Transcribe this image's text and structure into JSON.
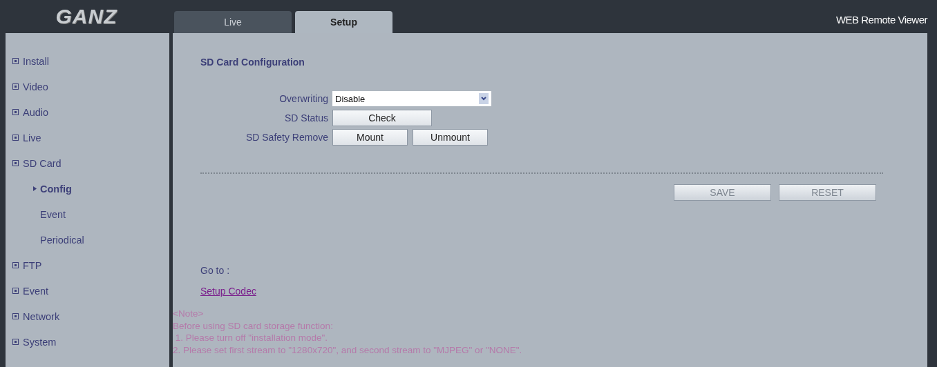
{
  "logo": {
    "text": "GANZ"
  },
  "tabs": [
    {
      "label": "Live",
      "selected": false
    },
    {
      "label": "Setup",
      "selected": true
    }
  ],
  "app_title": "WEB Remote Viewer",
  "sidebar": {
    "items": [
      {
        "label": "Install",
        "selected": false
      },
      {
        "label": "Video",
        "selected": false
      },
      {
        "label": "Audio",
        "selected": false
      },
      {
        "label": "Live",
        "selected": false
      },
      {
        "label": "SD Card",
        "selected": false,
        "children": [
          {
            "label": "Config",
            "selected": true
          },
          {
            "label": "Event",
            "selected": false
          },
          {
            "label": "Periodical",
            "selected": false
          }
        ]
      },
      {
        "label": "FTP",
        "selected": false
      },
      {
        "label": "Event",
        "selected": false
      },
      {
        "label": "Network",
        "selected": false
      },
      {
        "label": "System",
        "selected": false
      }
    ]
  },
  "section_title": "SD Card Configuration",
  "form": [
    {
      "kind": "select",
      "label": "Overwriting",
      "value": "Disable"
    },
    {
      "kind": "buttons",
      "label": "SD Status",
      "buttons": [
        "Check"
      ]
    },
    {
      "kind": "buttons",
      "label": "SD Safety Remove",
      "buttons": [
        "Mount",
        "Unmount"
      ]
    }
  ],
  "actions": [
    {
      "label": "SAVE",
      "disabled": true
    },
    {
      "label": "RESET",
      "disabled": true
    }
  ],
  "goto": {
    "label": "Go to :",
    "link": "Setup Codec"
  },
  "note": [
    "<Note>",
    "Before using SD card storage function:",
    " 1. Please turn off \"installation mode\".",
    "2. Please set first stream to \"1280x720\", and second stream to \"MJPEG\" or \"NONE\"."
  ]
}
